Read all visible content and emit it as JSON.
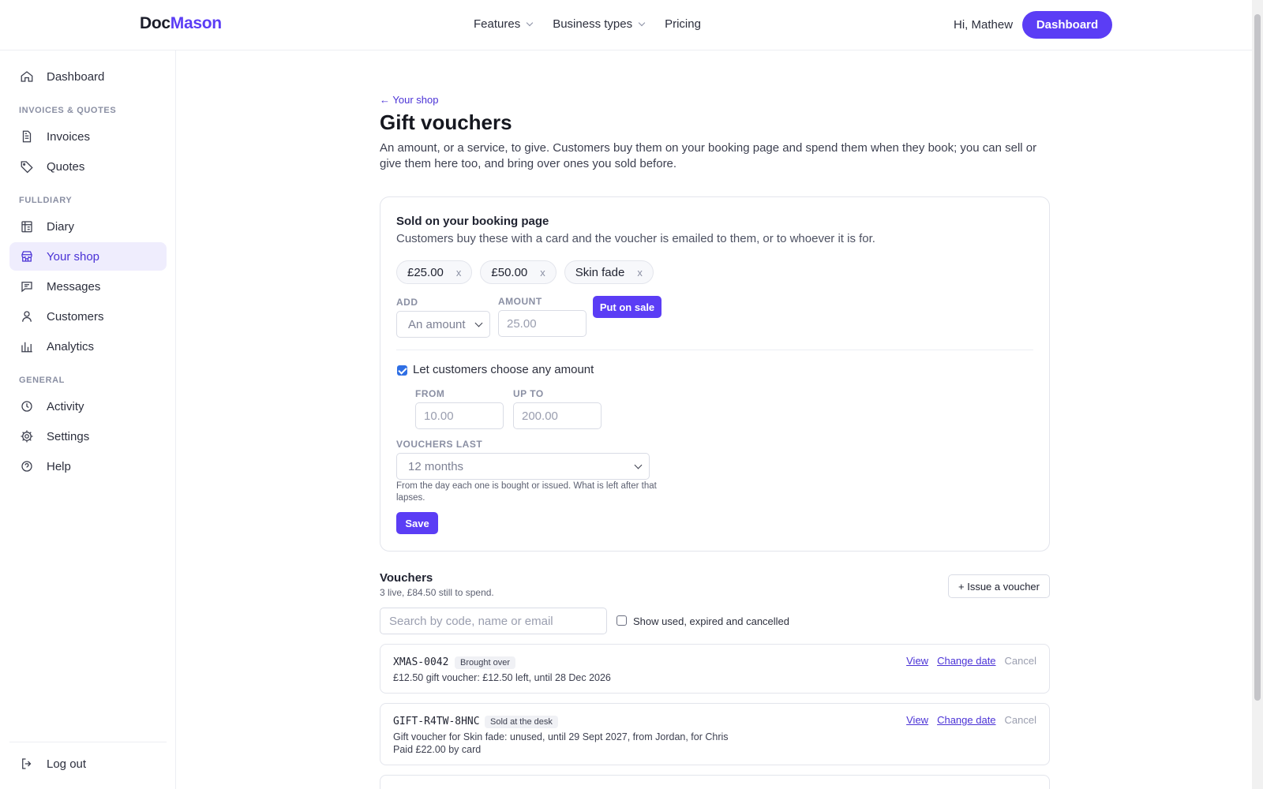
{
  "brand": {
    "part1": "Doc",
    "part2": "Mason"
  },
  "topnav": {
    "features": "Features",
    "business_types": "Business types",
    "pricing": "Pricing",
    "greeting": "Hi, Mathew",
    "dashboard": "Dashboard"
  },
  "sidebar": {
    "dashboard": "Dashboard",
    "section_invoices": "INVOICES & QUOTES",
    "invoices": "Invoices",
    "quotes": "Quotes",
    "section_fulldiary": "FULLDIARY",
    "diary": "Diary",
    "your_shop": "Your shop",
    "messages": "Messages",
    "customers": "Customers",
    "analytics": "Analytics",
    "section_general": "GENERAL",
    "activity": "Activity",
    "settings": "Settings",
    "help": "Help",
    "logout": "Log out"
  },
  "page": {
    "back": "← Your shop",
    "title": "Gift vouchers",
    "intro": "An amount, or a service, to give. Customers buy them on your booking page and spend them when they book; you can sell or give them here too, and bring over ones you sold before."
  },
  "booking": {
    "title": "Sold on your booking page",
    "subtitle": "Customers buy these with a card and the voucher is emailed to them, or to whoever it is for.",
    "chips": [
      "£25.00",
      "£50.00",
      "Skin fade"
    ],
    "chip_remove": "x",
    "add_label": "ADD",
    "add_value": "An amount",
    "amount_label": "AMOUNT",
    "amount_placeholder": "25.00",
    "put_on_sale": "Put on sale",
    "any_amount_label": "Let customers choose any amount",
    "any_amount_checked": true,
    "from_label": "FROM",
    "from_placeholder": "10.00",
    "upto_label": "UP TO",
    "upto_placeholder": "200.00",
    "last_label": "VOUCHERS LAST",
    "last_value": "12 months",
    "hint": "From the day each one is bought or issued. What is left after that lapses.",
    "save": "Save"
  },
  "vouchers": {
    "title": "Vouchers",
    "summary": "3 live, £84.50 still to spend.",
    "issue": "+ Issue a voucher",
    "search_placeholder": "Search by code, name or email",
    "show_all_label": "Show used, expired and cancelled",
    "show_all_checked": false,
    "view": "View",
    "change_date": "Change date",
    "cancel": "Cancel",
    "items": [
      {
        "code": "XMAS-0042",
        "badge": "Brought over",
        "desc": "£12.50 gift voucher: £12.50 left, until 28 Dec 2026",
        "paid": ""
      },
      {
        "code": "GIFT-R4TW-8HNC",
        "badge": "Sold at the desk",
        "desc": "Gift voucher for Skin fade: unused, until 29 Sept 2027, from Jordan, for Chris",
        "paid": "Paid £22.00 by card"
      }
    ]
  },
  "colors": {
    "accent": "#5b3df5",
    "active_bg": "#efedfd",
    "checkbox": "#2f6fe4"
  }
}
